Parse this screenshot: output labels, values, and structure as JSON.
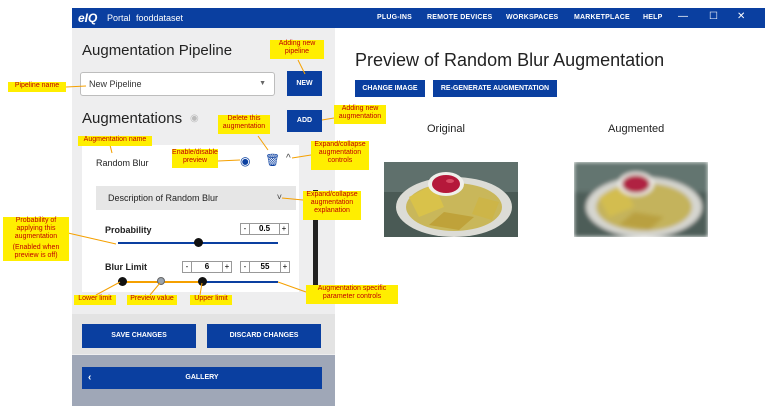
{
  "topbar": {
    "brand": "eIQ",
    "portal": "Portal",
    "dataset": "fooddataset",
    "nav": [
      "PLUG-INS",
      "REMOTE DEVICES",
      "WORKSPACES",
      "MARKETPLACE",
      "HELP"
    ],
    "window_controls": [
      "—",
      "☐",
      "✕"
    ]
  },
  "left": {
    "pipeline_title": "Augmentation Pipeline",
    "pipeline_select_value": "New Pipeline",
    "new_label": "NEW",
    "augmentations_title": "Augmentations",
    "add_label": "ADD",
    "augmentation_name": "Random Blur",
    "description_title": "Description of Random Blur",
    "probability_label": "Probability",
    "probability_value": "0.5",
    "probability_fraction": 0.5,
    "blur_limit_label": "Blur Limit",
    "blur_lower": "6",
    "blur_upper": "55",
    "spin_minus": "-",
    "spin_plus": "+",
    "save_label": "SAVE CHANGES",
    "discard_label": "DISCARD CHANGES",
    "gallery_label": "GALLERY",
    "gallery_chevron": "‹"
  },
  "right": {
    "title": "Preview of Random Blur Augmentation",
    "change_image_label": "CHANGE IMAGE",
    "regenerate_label": "RE-GENERATE AUGMENTATION",
    "original_label": "Original",
    "augmented_label": "Augmented"
  },
  "annotations": {
    "adding_pipeline": "Adding new pipeline",
    "pipeline_name": "Pipeline name",
    "delete_aug": "Delete this augmentation",
    "adding_aug": "Adding new augmentation",
    "aug_name": "Augmentation name",
    "enable_disable": "Enable/disable preview",
    "expand_controls": "Expand/collapse augmentation controls",
    "expand_explanation": "Expand/collapse augmentation explanation",
    "probability_note_1": "Probability of applying this augmentation",
    "probability_note_2": "(Enabled when preview is off)",
    "lower_limit": "Lower limit",
    "preview_value": "Preview value",
    "upper_limit": "Upper limit",
    "param_controls": "Augmentation specific parameter controls"
  },
  "colors": {
    "brand_blue": "#0a3fa0",
    "note_yellow": "#ffee00",
    "note_red": "#c00000",
    "track_orange": "#f5a000"
  },
  "icons": {
    "eye": "eye-icon",
    "trash": "trash-icon",
    "chevron": "chevron-icon"
  }
}
